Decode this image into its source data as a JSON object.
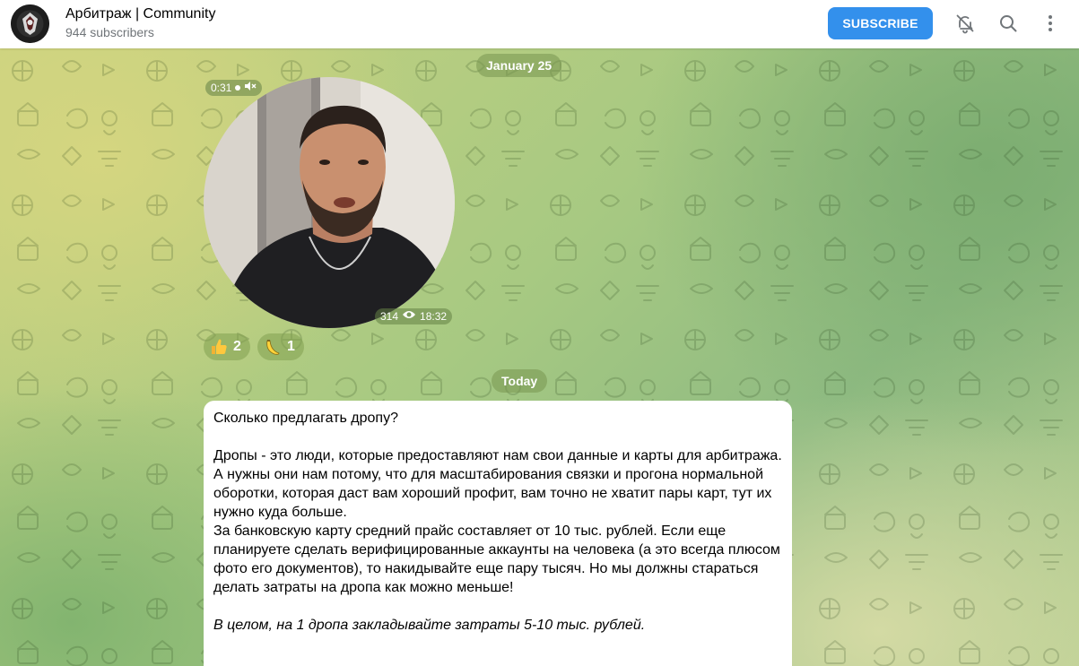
{
  "header": {
    "channel_title": "Арбитраж | Community",
    "subscribers": "944 subscribers",
    "subscribe_label": "SUBSCRIBE",
    "mute_icon": "bell-off-icon",
    "search_icon": "search-icon",
    "more_icon": "more-vertical-icon"
  },
  "colors": {
    "accent": "#3390ec",
    "header_bg": "#ffffff",
    "subtitle_text": "#707579"
  },
  "chat": {
    "date_separators": [
      "January 25",
      "Today"
    ],
    "video_message": {
      "duration": "0:31",
      "muted_icon": "speaker-muted-icon",
      "views": "314",
      "views_icon": "eye-icon",
      "time": "18:32"
    },
    "reactions": [
      {
        "emoji": "thumbs-up",
        "count": "2"
      },
      {
        "emoji": "banana",
        "count": "1"
      }
    ],
    "text_message": {
      "title": "Сколько предлагать дропу?",
      "paragraphs": [
        "Дропы - это люди, которые предоставляют нам свои данные и карты для арбитража.",
        "А нужны они нам потому, что для масштабирования связки и прогона нормальной оборотки, которая даст вам хороший профит, вам точно не хватит пары карт, тут их нужно куда больше.",
        "За банковскую карту средний прайс составляет от 10 тыс. рублей. Если еще планируете сделать верифицированные аккаунты на человека (а это всегда плюсом фото его документов), то накидывайте еще пару тысяч. Но мы должны стараться делать затраты на дропа как можно меньше!"
      ],
      "italic_note": "В целом, на 1 дропа закладывайте затраты 5-10 тыс. рублей."
    }
  }
}
